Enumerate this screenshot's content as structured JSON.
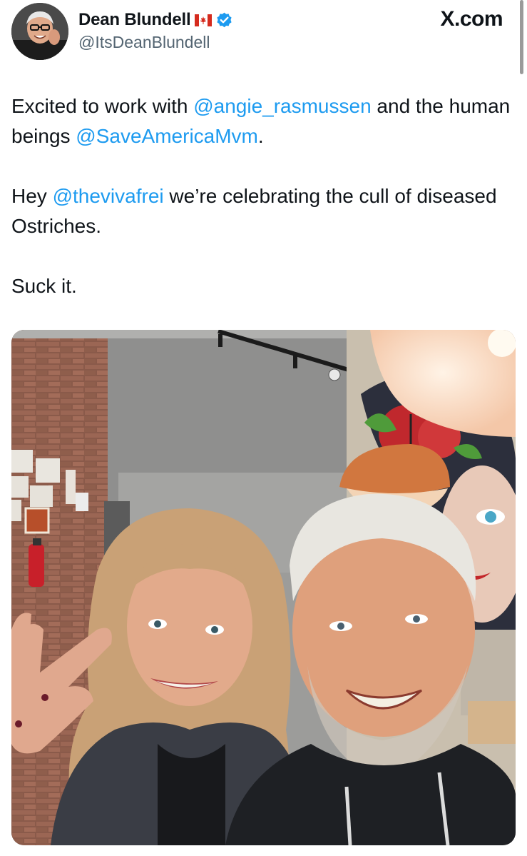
{
  "author": {
    "name": "Dean Blundell",
    "flag": "canada-flag-icon",
    "verified": true,
    "handle": "@ItsDeanBlundell"
  },
  "brand": {
    "logo_text": "X.com"
  },
  "tweet": {
    "line1_before": "Excited to work with ",
    "mention1": "@angie_rasmussen",
    "line1_after": " and the human beings ",
    "mention2": "@SaveAmericaMvm",
    "line1_end": ".",
    "para2_before": "Hey ",
    "mention3": "@thevivafrei",
    "para2_after": " we’re celebrating the cull of diseased Ostriches.",
    "para3": "Suck it."
  },
  "colors": {
    "link": "#1d9bf0",
    "text": "#0f1419",
    "secondary": "#536471",
    "verified": "#1d9bf0"
  }
}
